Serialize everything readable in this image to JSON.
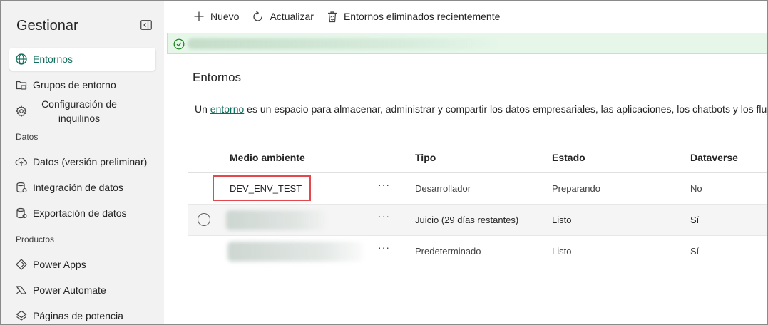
{
  "sidebar": {
    "title": "Gestionar",
    "items": [
      {
        "label": "Entornos",
        "icon": "globe-icon",
        "active": true
      },
      {
        "label": "Grupos de entorno",
        "icon": "folder-group-icon"
      },
      {
        "label": "Configuración de inquilinos",
        "icon": "gear-icon"
      }
    ],
    "section_data": "Datos",
    "data_items": [
      {
        "label": "Datos (versión preliminar)",
        "icon": "cloud-upload-icon"
      },
      {
        "label": "Integración de datos",
        "icon": "database-icon"
      },
      {
        "label": "Exportación de datos",
        "icon": "database-export-icon"
      }
    ],
    "section_products": "Productos",
    "product_items": [
      {
        "label": "Power Apps",
        "icon": "power-apps-icon"
      },
      {
        "label": "Power Automate",
        "icon": "power-automate-icon"
      },
      {
        "label": "Páginas de potencia",
        "icon": "power-pages-icon"
      }
    ]
  },
  "toolbar": {
    "new_label": "Nuevo",
    "refresh_label": "Actualizar",
    "deleted_label": "Entornos eliminados recientemente"
  },
  "page": {
    "title": "Entornos",
    "desc_prefix": "Un ",
    "desc_link": "entorno",
    "desc_suffix": " es un espacio para almacenar, administrar y compartir los datos empresariales, las aplicaciones, los chatbots y los flujos"
  },
  "table": {
    "columns": [
      "Medio ambiente",
      "Tipo",
      "Estado",
      "Dataverse"
    ],
    "rows": [
      {
        "name": "DEV_ENV_TEST",
        "type": "Desarrollador",
        "state": "Preparando",
        "dataverse": "No"
      },
      {
        "name": "",
        "type": "Juicio (29 días restantes)",
        "state": "Listo",
        "dataverse": "Sí"
      },
      {
        "name": "",
        "type": "Predeterminado",
        "state": "Listo",
        "dataverse": "Sí"
      }
    ],
    "more_label": "···"
  },
  "colors": {
    "accent": "#0f6d5c",
    "banner_bg": "#e6f7ea",
    "highlight": "#e4474c",
    "sidebar_bg": "#f2f2f2"
  }
}
